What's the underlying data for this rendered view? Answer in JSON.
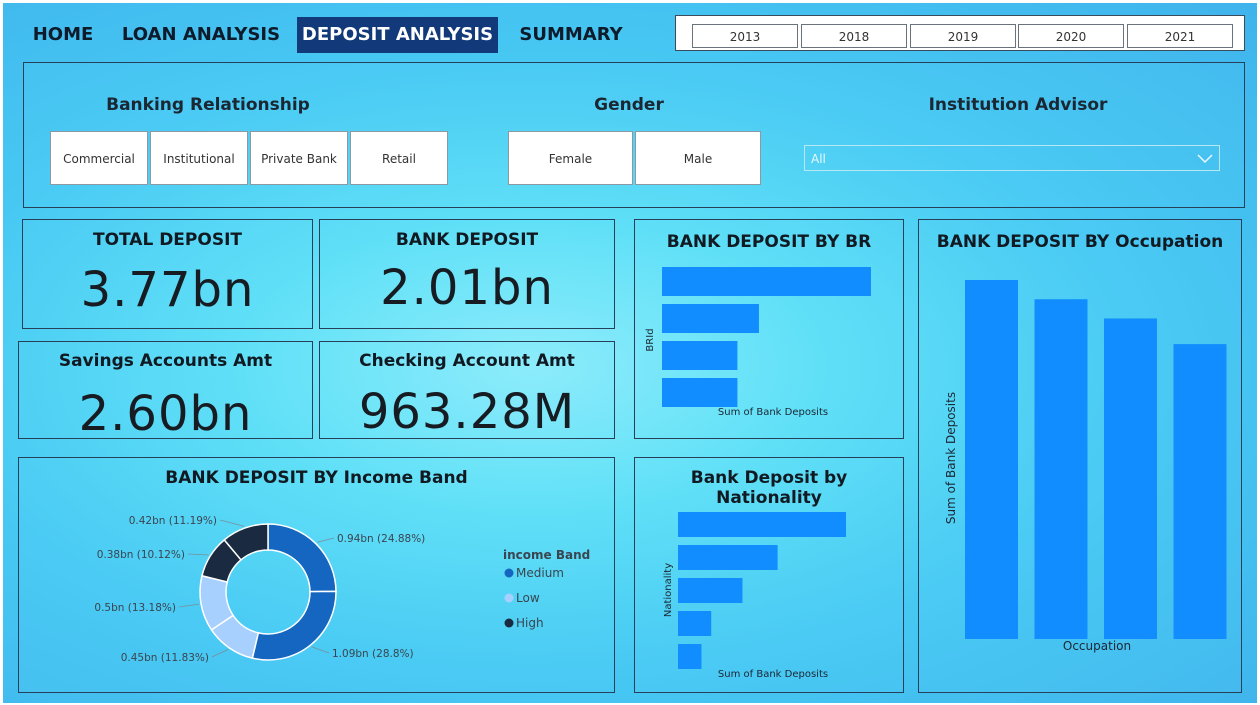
{
  "nav": {
    "tabs": [
      {
        "label": "HOME",
        "active": false
      },
      {
        "label": "LOAN ANALYSIS",
        "active": false
      },
      {
        "label": "DEPOSIT ANALYSIS",
        "active": true
      },
      {
        "label": "SUMMARY",
        "active": false
      }
    ],
    "years": [
      "2013",
      "2018",
      "2019",
      "2020",
      "2021"
    ]
  },
  "filters": {
    "banking_relationship": {
      "title": "Banking Relationship",
      "options": [
        "Commercial",
        "Institutional",
        "Private Bank",
        "Retail"
      ]
    },
    "gender": {
      "title": "Gender",
      "options": [
        "Female",
        "Male"
      ]
    },
    "institution_advisor": {
      "title": "Institution Advisor",
      "selected": "All"
    }
  },
  "kpis": {
    "total_deposit": {
      "label": "TOTAL DEPOSIT",
      "value": "3.77bn"
    },
    "bank_deposit": {
      "label": "BANK DEPOSIT",
      "value": "2.01bn"
    },
    "savings": {
      "label": "Savings Accounts Amt",
      "value": "2.60bn"
    },
    "checking": {
      "label": "Checking Account Amt",
      "value": "963.28M"
    }
  },
  "colors": {
    "bar": "#118dff",
    "donut": [
      "#1566c0",
      "#a7d0ff",
      "#1a2a40"
    ],
    "panel_border": "#27405a"
  },
  "chart_data": [
    {
      "id": "by_br",
      "type": "bar",
      "orientation": "horizontal",
      "title": "BANK DEPOSIT BY BR",
      "ylabel": "BRId",
      "xlabel": "Sum of Bank Deposits",
      "series": [
        {
          "values": [
            0.97,
            0.45,
            0.35,
            0.35
          ]
        }
      ]
    },
    {
      "id": "by_occupation",
      "type": "bar",
      "orientation": "vertical",
      "title": "BANK DEPOSIT BY Occupation",
      "xlabel": "Occupation",
      "ylabel": "Sum of Bank Deposits",
      "series": [
        {
          "values": [
            0.56,
            0.53,
            0.5,
            0.46
          ]
        }
      ]
    },
    {
      "id": "by_nationality",
      "type": "bar",
      "orientation": "horizontal",
      "title": "Bank Deposit by Nationality",
      "ylabel": "Nationality",
      "xlabel": "Sum of Bank Deposits",
      "series": [
        {
          "values": [
            0.86,
            0.51,
            0.33,
            0.17,
            0.12
          ]
        }
      ]
    },
    {
      "id": "by_income",
      "type": "pie",
      "variant": "donut",
      "title": "BANK DEPOSIT BY Income Band",
      "legend_title": "income Band",
      "legend_position": "right",
      "legend": [
        "Medium",
        "Low",
        "High"
      ],
      "slices": [
        {
          "category": "Medium",
          "value": 0.94,
          "label": "0.94bn (24.88%)"
        },
        {
          "category": "Medium",
          "value": 1.09,
          "label": "1.09bn (28.8%)"
        },
        {
          "category": "Low",
          "value": 0.45,
          "label": "0.45bn (11.83%)"
        },
        {
          "category": "Low",
          "value": 0.5,
          "label": "0.5bn (13.18%)"
        },
        {
          "category": "High",
          "value": 0.38,
          "label": "0.38bn (10.12%)"
        },
        {
          "category": "High",
          "value": 0.42,
          "label": "0.42bn (11.19%)"
        }
      ]
    }
  ]
}
